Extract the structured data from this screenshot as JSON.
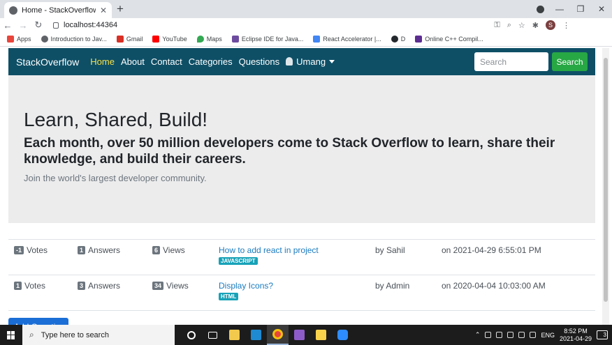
{
  "browser": {
    "tab_title": "Home - StackOverflow",
    "url": "localhost:44364",
    "profile_initial": "S",
    "bookmarks": [
      {
        "label": "Apps",
        "icon": "apps-grid-icon",
        "color": "#e8453c"
      },
      {
        "label": "Introduction to Jav...",
        "icon": "globe-icon",
        "color": "#5f6368"
      },
      {
        "label": "Gmail",
        "icon": "gmail-icon",
        "color": "#d93025"
      },
      {
        "label": "YouTube",
        "icon": "youtube-icon",
        "color": "#ff0000"
      },
      {
        "label": "Maps",
        "icon": "maps-icon",
        "color": "#34a853"
      },
      {
        "label": "Eclipse IDE for Java...",
        "icon": "eclipse-icon",
        "color": "#6d4c9f"
      },
      {
        "label": "React Accelerator |...",
        "icon": "document-icon",
        "color": "#4285f4"
      },
      {
        "label": "D",
        "icon": "github-icon",
        "color": "#24292e"
      },
      {
        "label": "Online C++ Compil...",
        "icon": "compiler-icon",
        "color": "#5c2d91"
      }
    ]
  },
  "navbar": {
    "brand": "StackOverflow",
    "links": [
      "Home",
      "About",
      "Contact",
      "Categories",
      "Questions"
    ],
    "user": "Umang",
    "search_placeholder": "Search",
    "search_button": "Search",
    "bg_color": "#0e4f66",
    "active_color": "#f5e04a"
  },
  "hero": {
    "title": "Learn, Shared, Build!",
    "subtitle": "Each month, over 50 million developers come to Stack Overflow to learn, share their knowledge, and build their careers.",
    "lead": "Join the world's largest developer community."
  },
  "questions": [
    {
      "votes": "-1",
      "votes_label": "Votes",
      "answers": "1",
      "answers_label": "Answers",
      "views": "6",
      "views_label": "Views",
      "title": "How to add react in project",
      "tag": "JAVASCRIPT",
      "author": "by Sahil",
      "date": "on 2021-04-29 6:55:01 PM"
    },
    {
      "votes": "1",
      "votes_label": "Votes",
      "answers": "3",
      "answers_label": "Answers",
      "views": "34",
      "views_label": "Views",
      "title": "Display Icons?",
      "tag": "HTML",
      "author": "by Admin",
      "date": "on 2020-04-04 10:03:00 AM"
    }
  ],
  "add_question_label": "Add Question",
  "taskbar": {
    "search_text": "Type here to search",
    "lang": "ENG",
    "time": "8:52 PM",
    "date": "2021-04-29",
    "notification_count": "3"
  }
}
